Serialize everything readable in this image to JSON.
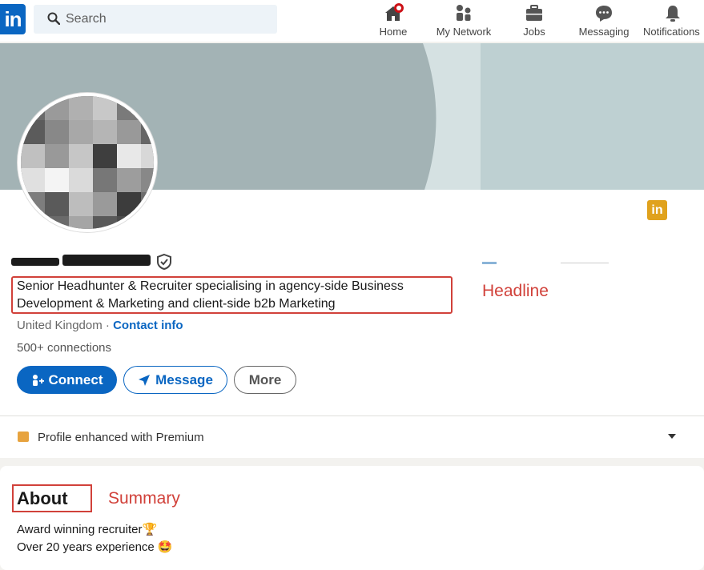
{
  "nav": {
    "logo": "in",
    "search_placeholder": "Search",
    "items": [
      {
        "label": "Home",
        "icon": "home-icon"
      },
      {
        "label": "My Network",
        "icon": "people-icon"
      },
      {
        "label": "Jobs",
        "icon": "briefcase-icon"
      },
      {
        "label": "Messaging",
        "icon": "chat-icon"
      },
      {
        "label": "Notifications",
        "icon": "bell-icon"
      }
    ]
  },
  "profile": {
    "company_badge": "in",
    "headline": "Senior Headhunter & Recruiter specialising in agency-side Business Development & Marketing and client-side b2b Marketing",
    "location": "United Kingdom",
    "separator": " · ",
    "contact_info": "Contact info",
    "connections": "500+ connections",
    "actions": {
      "connect": "Connect",
      "message": "Message",
      "more": "More"
    },
    "premium_text": "Profile enhanced with Premium"
  },
  "annotations": {
    "headline": "Headline",
    "summary": "Summary"
  },
  "about": {
    "title": "About",
    "lines": [
      "Award winning recruiter🏆",
      "Over 20 years experience 🤩"
    ]
  },
  "colors": {
    "brand": "#0a66c2",
    "annotation": "#d1413a",
    "premium": "#e7a33e"
  }
}
